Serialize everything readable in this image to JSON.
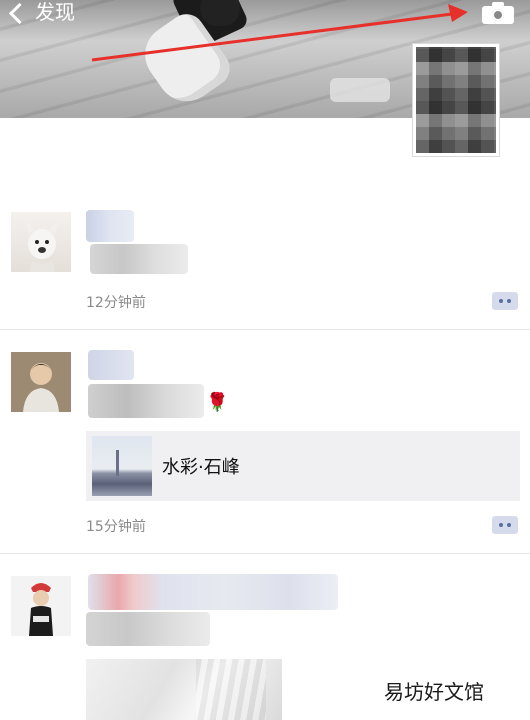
{
  "header": {
    "back_label": "发现",
    "icons": {
      "back": "chevron-left-icon",
      "camera": "camera-icon"
    }
  },
  "feed": {
    "posts": [
      {
        "time": "12分钟前"
      },
      {
        "text_suffix": "🌹",
        "link_title": "水彩·石峰",
        "time": "15分钟前"
      },
      {}
    ]
  },
  "watermark": "易坊好文馆",
  "colors": {
    "annotation_arrow": "#e8302b",
    "link_card_bg": "#f0f0f2",
    "comment_button_bg": "#d6dbec",
    "comment_button_dots": "#5a6ea0",
    "time_text": "#8a8a8a"
  }
}
